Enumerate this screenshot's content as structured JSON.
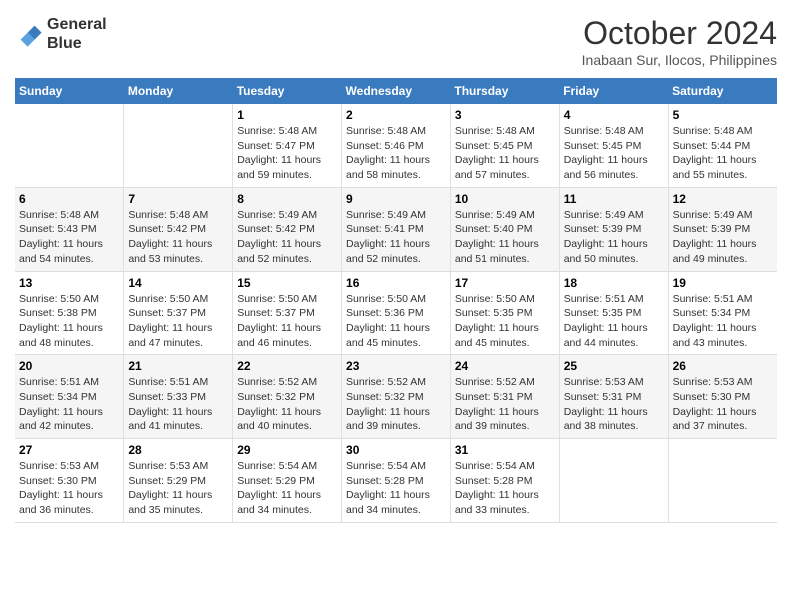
{
  "header": {
    "logo_line1": "General",
    "logo_line2": "Blue",
    "month": "October 2024",
    "location": "Inabaan Sur, Ilocos, Philippines"
  },
  "days_of_week": [
    "Sunday",
    "Monday",
    "Tuesday",
    "Wednesday",
    "Thursday",
    "Friday",
    "Saturday"
  ],
  "weeks": [
    [
      {
        "day": "",
        "sunrise": "",
        "sunset": "",
        "daylight": ""
      },
      {
        "day": "",
        "sunrise": "",
        "sunset": "",
        "daylight": ""
      },
      {
        "day": "1",
        "sunrise": "Sunrise: 5:48 AM",
        "sunset": "Sunset: 5:47 PM",
        "daylight": "Daylight: 11 hours and 59 minutes."
      },
      {
        "day": "2",
        "sunrise": "Sunrise: 5:48 AM",
        "sunset": "Sunset: 5:46 PM",
        "daylight": "Daylight: 11 hours and 58 minutes."
      },
      {
        "day": "3",
        "sunrise": "Sunrise: 5:48 AM",
        "sunset": "Sunset: 5:45 PM",
        "daylight": "Daylight: 11 hours and 57 minutes."
      },
      {
        "day": "4",
        "sunrise": "Sunrise: 5:48 AM",
        "sunset": "Sunset: 5:45 PM",
        "daylight": "Daylight: 11 hours and 56 minutes."
      },
      {
        "day": "5",
        "sunrise": "Sunrise: 5:48 AM",
        "sunset": "Sunset: 5:44 PM",
        "daylight": "Daylight: 11 hours and 55 minutes."
      }
    ],
    [
      {
        "day": "6",
        "sunrise": "Sunrise: 5:48 AM",
        "sunset": "Sunset: 5:43 PM",
        "daylight": "Daylight: 11 hours and 54 minutes."
      },
      {
        "day": "7",
        "sunrise": "Sunrise: 5:48 AM",
        "sunset": "Sunset: 5:42 PM",
        "daylight": "Daylight: 11 hours and 53 minutes."
      },
      {
        "day": "8",
        "sunrise": "Sunrise: 5:49 AM",
        "sunset": "Sunset: 5:42 PM",
        "daylight": "Daylight: 11 hours and 52 minutes."
      },
      {
        "day": "9",
        "sunrise": "Sunrise: 5:49 AM",
        "sunset": "Sunset: 5:41 PM",
        "daylight": "Daylight: 11 hours and 52 minutes."
      },
      {
        "day": "10",
        "sunrise": "Sunrise: 5:49 AM",
        "sunset": "Sunset: 5:40 PM",
        "daylight": "Daylight: 11 hours and 51 minutes."
      },
      {
        "day": "11",
        "sunrise": "Sunrise: 5:49 AM",
        "sunset": "Sunset: 5:39 PM",
        "daylight": "Daylight: 11 hours and 50 minutes."
      },
      {
        "day": "12",
        "sunrise": "Sunrise: 5:49 AM",
        "sunset": "Sunset: 5:39 PM",
        "daylight": "Daylight: 11 hours and 49 minutes."
      }
    ],
    [
      {
        "day": "13",
        "sunrise": "Sunrise: 5:50 AM",
        "sunset": "Sunset: 5:38 PM",
        "daylight": "Daylight: 11 hours and 48 minutes."
      },
      {
        "day": "14",
        "sunrise": "Sunrise: 5:50 AM",
        "sunset": "Sunset: 5:37 PM",
        "daylight": "Daylight: 11 hours and 47 minutes."
      },
      {
        "day": "15",
        "sunrise": "Sunrise: 5:50 AM",
        "sunset": "Sunset: 5:37 PM",
        "daylight": "Daylight: 11 hours and 46 minutes."
      },
      {
        "day": "16",
        "sunrise": "Sunrise: 5:50 AM",
        "sunset": "Sunset: 5:36 PM",
        "daylight": "Daylight: 11 hours and 45 minutes."
      },
      {
        "day": "17",
        "sunrise": "Sunrise: 5:50 AM",
        "sunset": "Sunset: 5:35 PM",
        "daylight": "Daylight: 11 hours and 45 minutes."
      },
      {
        "day": "18",
        "sunrise": "Sunrise: 5:51 AM",
        "sunset": "Sunset: 5:35 PM",
        "daylight": "Daylight: 11 hours and 44 minutes."
      },
      {
        "day": "19",
        "sunrise": "Sunrise: 5:51 AM",
        "sunset": "Sunset: 5:34 PM",
        "daylight": "Daylight: 11 hours and 43 minutes."
      }
    ],
    [
      {
        "day": "20",
        "sunrise": "Sunrise: 5:51 AM",
        "sunset": "Sunset: 5:34 PM",
        "daylight": "Daylight: 11 hours and 42 minutes."
      },
      {
        "day": "21",
        "sunrise": "Sunrise: 5:51 AM",
        "sunset": "Sunset: 5:33 PM",
        "daylight": "Daylight: 11 hours and 41 minutes."
      },
      {
        "day": "22",
        "sunrise": "Sunrise: 5:52 AM",
        "sunset": "Sunset: 5:32 PM",
        "daylight": "Daylight: 11 hours and 40 minutes."
      },
      {
        "day": "23",
        "sunrise": "Sunrise: 5:52 AM",
        "sunset": "Sunset: 5:32 PM",
        "daylight": "Daylight: 11 hours and 39 minutes."
      },
      {
        "day": "24",
        "sunrise": "Sunrise: 5:52 AM",
        "sunset": "Sunset: 5:31 PM",
        "daylight": "Daylight: 11 hours and 39 minutes."
      },
      {
        "day": "25",
        "sunrise": "Sunrise: 5:53 AM",
        "sunset": "Sunset: 5:31 PM",
        "daylight": "Daylight: 11 hours and 38 minutes."
      },
      {
        "day": "26",
        "sunrise": "Sunrise: 5:53 AM",
        "sunset": "Sunset: 5:30 PM",
        "daylight": "Daylight: 11 hours and 37 minutes."
      }
    ],
    [
      {
        "day": "27",
        "sunrise": "Sunrise: 5:53 AM",
        "sunset": "Sunset: 5:30 PM",
        "daylight": "Daylight: 11 hours and 36 minutes."
      },
      {
        "day": "28",
        "sunrise": "Sunrise: 5:53 AM",
        "sunset": "Sunset: 5:29 PM",
        "daylight": "Daylight: 11 hours and 35 minutes."
      },
      {
        "day": "29",
        "sunrise": "Sunrise: 5:54 AM",
        "sunset": "Sunset: 5:29 PM",
        "daylight": "Daylight: 11 hours and 34 minutes."
      },
      {
        "day": "30",
        "sunrise": "Sunrise: 5:54 AM",
        "sunset": "Sunset: 5:28 PM",
        "daylight": "Daylight: 11 hours and 34 minutes."
      },
      {
        "day": "31",
        "sunrise": "Sunrise: 5:54 AM",
        "sunset": "Sunset: 5:28 PM",
        "daylight": "Daylight: 11 hours and 33 minutes."
      },
      {
        "day": "",
        "sunrise": "",
        "sunset": "",
        "daylight": ""
      },
      {
        "day": "",
        "sunrise": "",
        "sunset": "",
        "daylight": ""
      }
    ]
  ]
}
